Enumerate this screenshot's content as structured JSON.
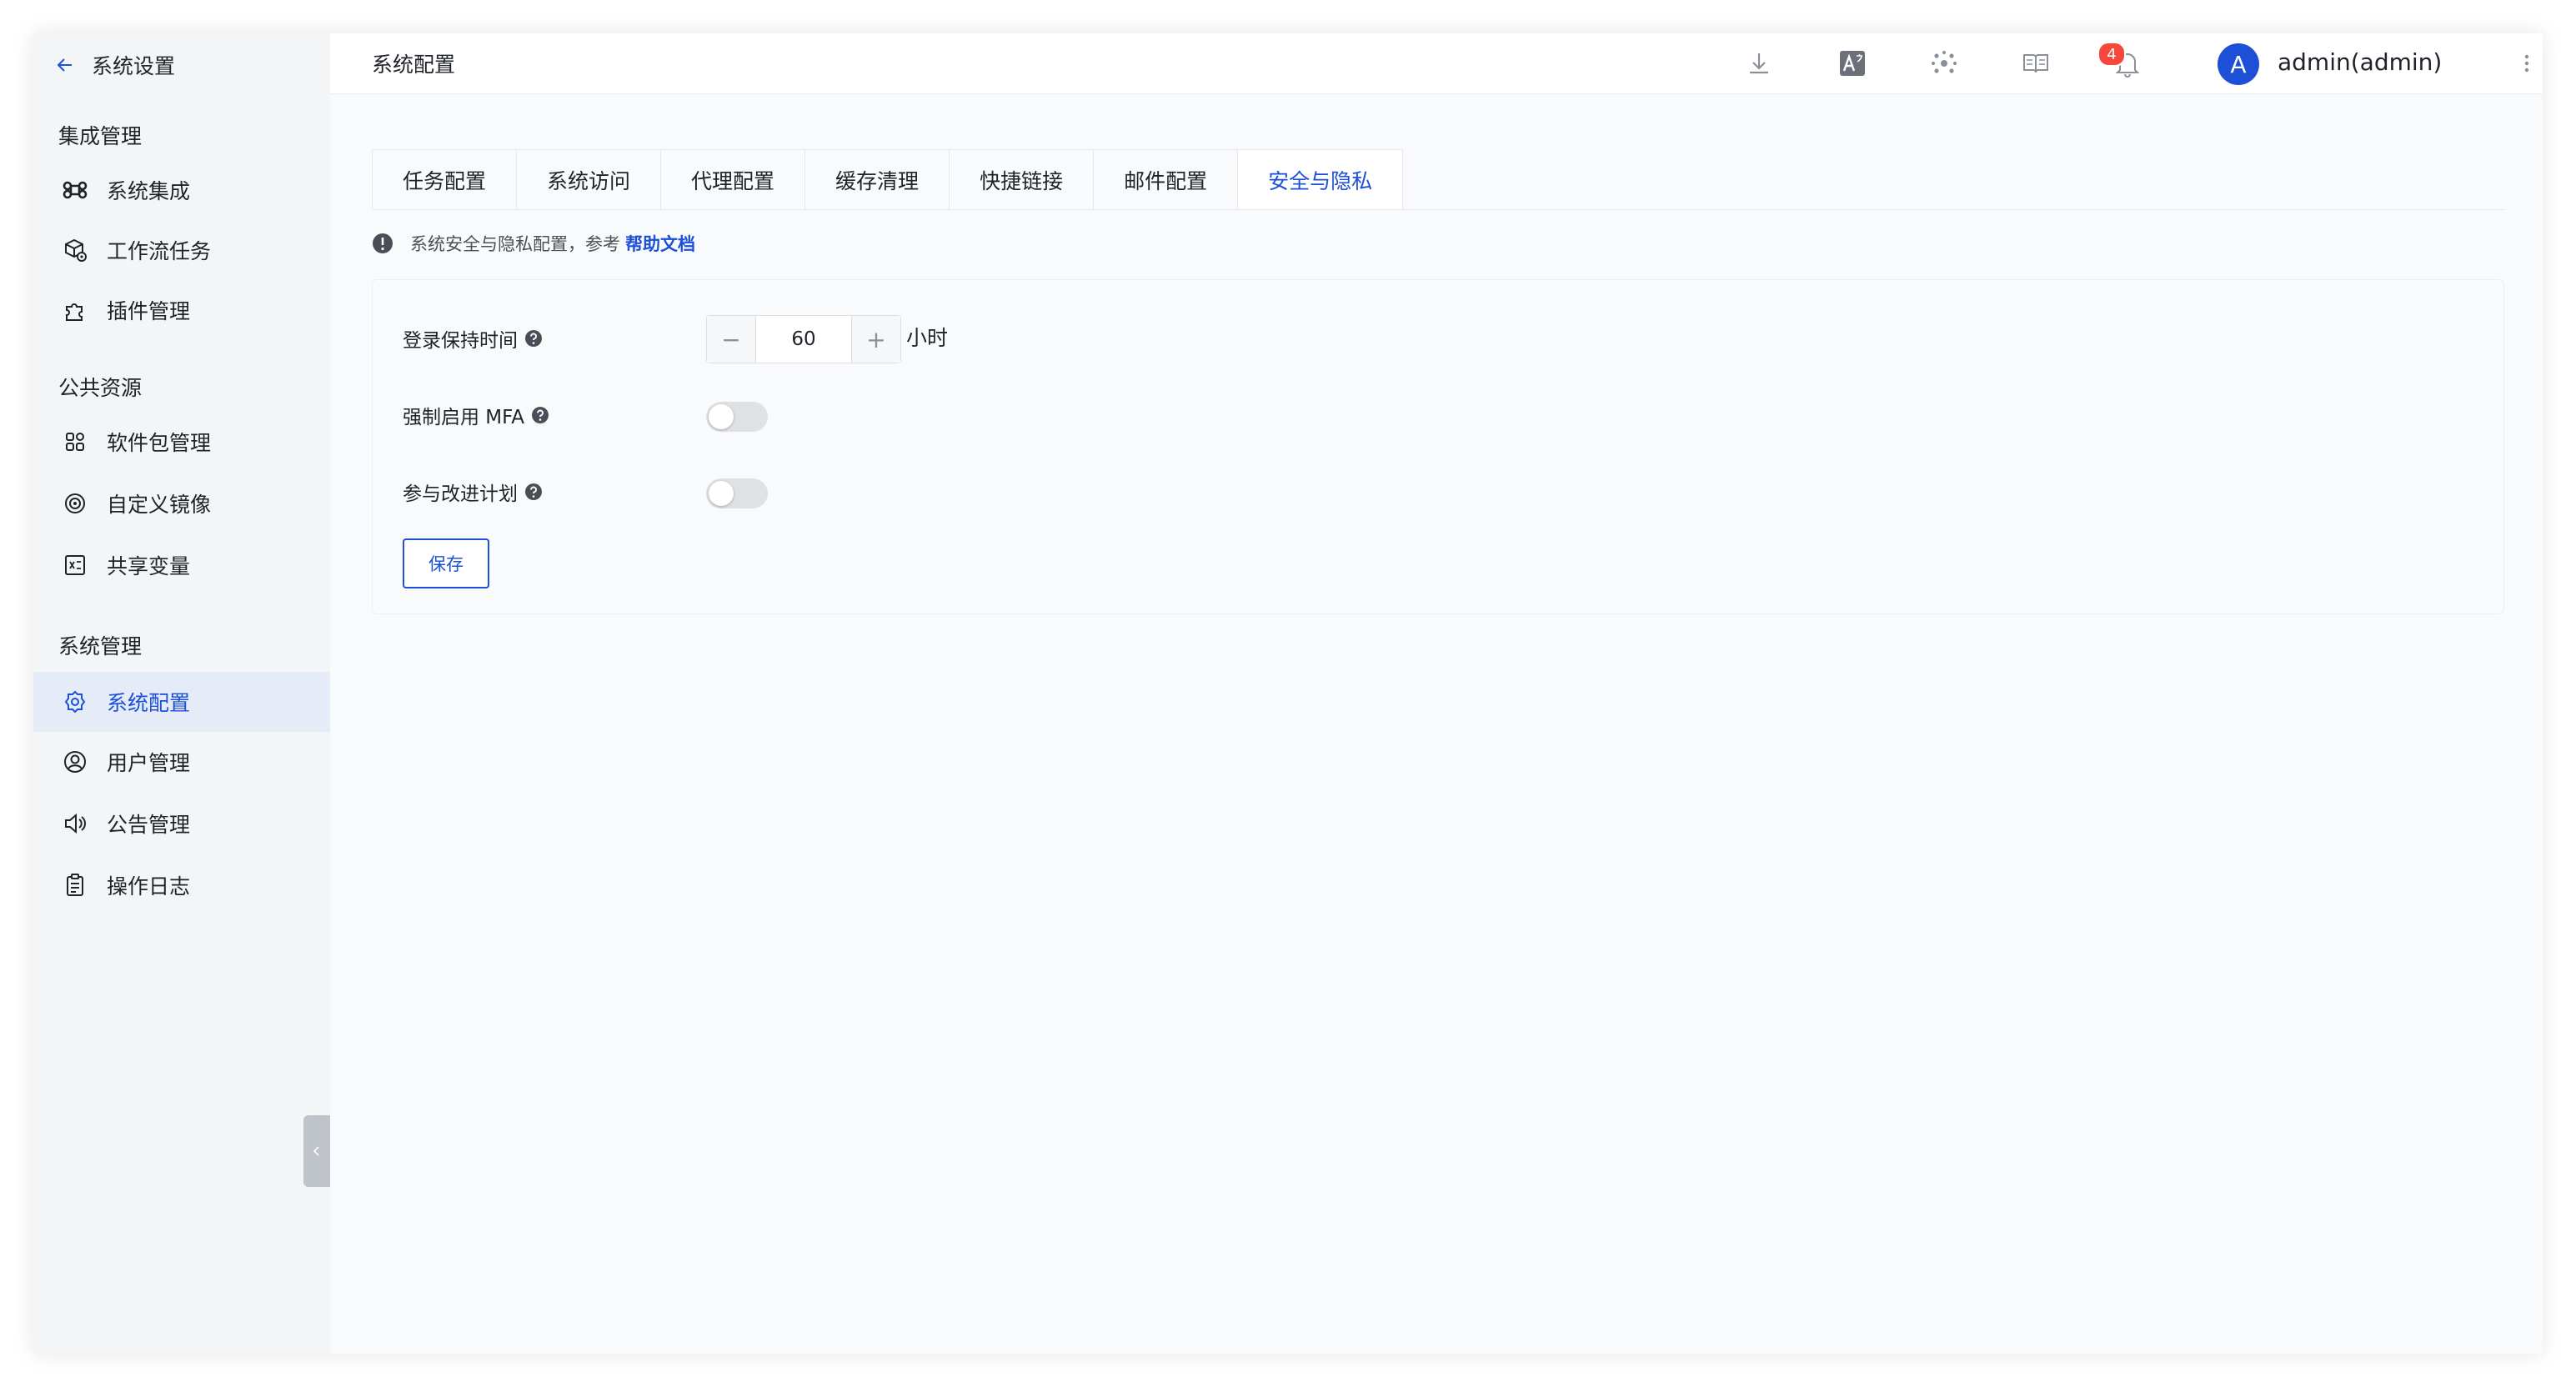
{
  "sidebar": {
    "back_label": "系统设置",
    "groups": [
      {
        "title": "集成管理",
        "items": [
          {
            "label": "系统集成",
            "icon": "command-icon"
          },
          {
            "label": "工作流任务",
            "icon": "workflow-icon"
          },
          {
            "label": "插件管理",
            "icon": "puzzle-icon"
          }
        ]
      },
      {
        "title": "公共资源",
        "items": [
          {
            "label": "软件包管理",
            "icon": "grid-icon"
          },
          {
            "label": "自定义镜像",
            "icon": "image-icon"
          },
          {
            "label": "共享变量",
            "icon": "variable-icon"
          }
        ]
      },
      {
        "title": "系统管理",
        "items": [
          {
            "label": "系统配置",
            "icon": "settings-icon",
            "active": true
          },
          {
            "label": "用户管理",
            "icon": "user-icon"
          },
          {
            "label": "公告管理",
            "icon": "speaker-icon"
          },
          {
            "label": "操作日志",
            "icon": "clipboard-icon"
          }
        ]
      }
    ]
  },
  "header": {
    "page_title": "系统配置",
    "notification_count": "4",
    "avatar_initial": "A",
    "username": "admin(admin)"
  },
  "tabs": [
    {
      "label": "任务配置"
    },
    {
      "label": "系统访问"
    },
    {
      "label": "代理配置"
    },
    {
      "label": "缓存清理"
    },
    {
      "label": "快捷链接"
    },
    {
      "label": "邮件配置"
    },
    {
      "label": "安全与隐私",
      "active": true
    }
  ],
  "info": {
    "text": "系统安全与隐私配置，参考",
    "link": "帮助文档"
  },
  "form": {
    "session": {
      "label": "登录保持时间",
      "value": "60",
      "unit": "小时"
    },
    "mfa": {
      "label": "强制启用 MFA",
      "enabled": false
    },
    "improvement": {
      "label": "参与改进计划",
      "enabled": false
    },
    "save_label": "保存"
  },
  "colors": {
    "accent": "#1d4fd7",
    "badge": "#f5483b",
    "sidebar_bg": "#f4f5f7",
    "active_item_bg": "#e6ebf8"
  }
}
